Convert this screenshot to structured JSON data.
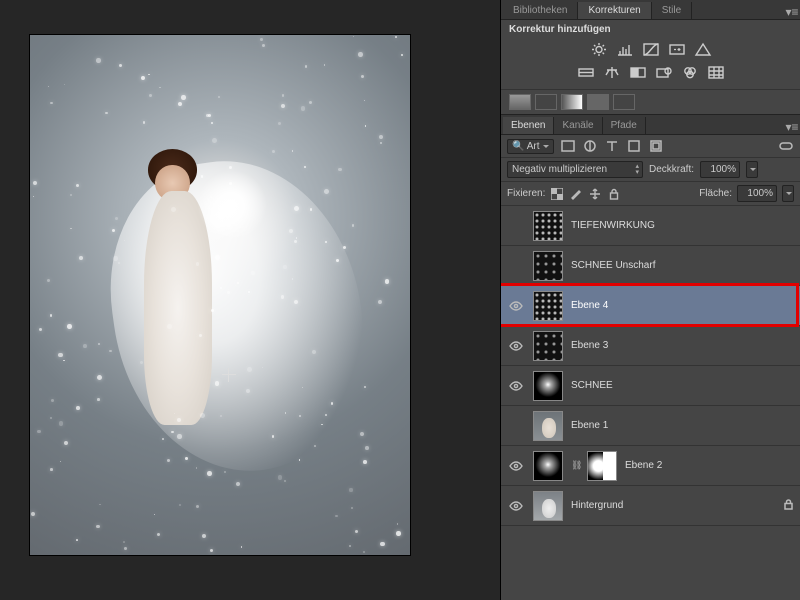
{
  "panel_tabs": {
    "libraries": "Bibliotheken",
    "adjustments": "Korrekturen",
    "styles": "Stile"
  },
  "adjustments": {
    "title": "Korrektur hinzufügen"
  },
  "layer_tabs": {
    "layers": "Ebenen",
    "channels": "Kanäle",
    "paths": "Pfade"
  },
  "layer_toolbar": {
    "filter": "Art"
  },
  "blend_row": {
    "mode": "Negativ multiplizieren",
    "opacity_label": "Deckkraft:",
    "opacity_value": "100%"
  },
  "lock_row": {
    "label": "Fixieren:",
    "fill_label": "Fläche:",
    "fill_value": "100%"
  },
  "layers": [
    {
      "name": "TIEFENWIRKUNG",
      "visible": false,
      "thumb": "t-snow",
      "selected": false
    },
    {
      "name": "SCHNEE Unscharf",
      "visible": false,
      "thumb": "t-snow2",
      "selected": false
    },
    {
      "name": "Ebene 4",
      "visible": true,
      "thumb": "t-snow",
      "selected": true,
      "highlight": true
    },
    {
      "name": "Ebene 3",
      "visible": true,
      "thumb": "t-snow2",
      "selected": false
    },
    {
      "name": "SCHNEE",
      "visible": true,
      "thumb": "t-flare",
      "selected": false
    },
    {
      "name": "Ebene 1",
      "visible": false,
      "thumb": "t-figure",
      "selected": false
    },
    {
      "name": "Ebene 2",
      "visible": true,
      "thumb": "t-flare",
      "selected": false,
      "mask": true
    },
    {
      "name": "Hintergrund",
      "visible": true,
      "thumb": "t-bg",
      "selected": false,
      "locked": true
    }
  ]
}
